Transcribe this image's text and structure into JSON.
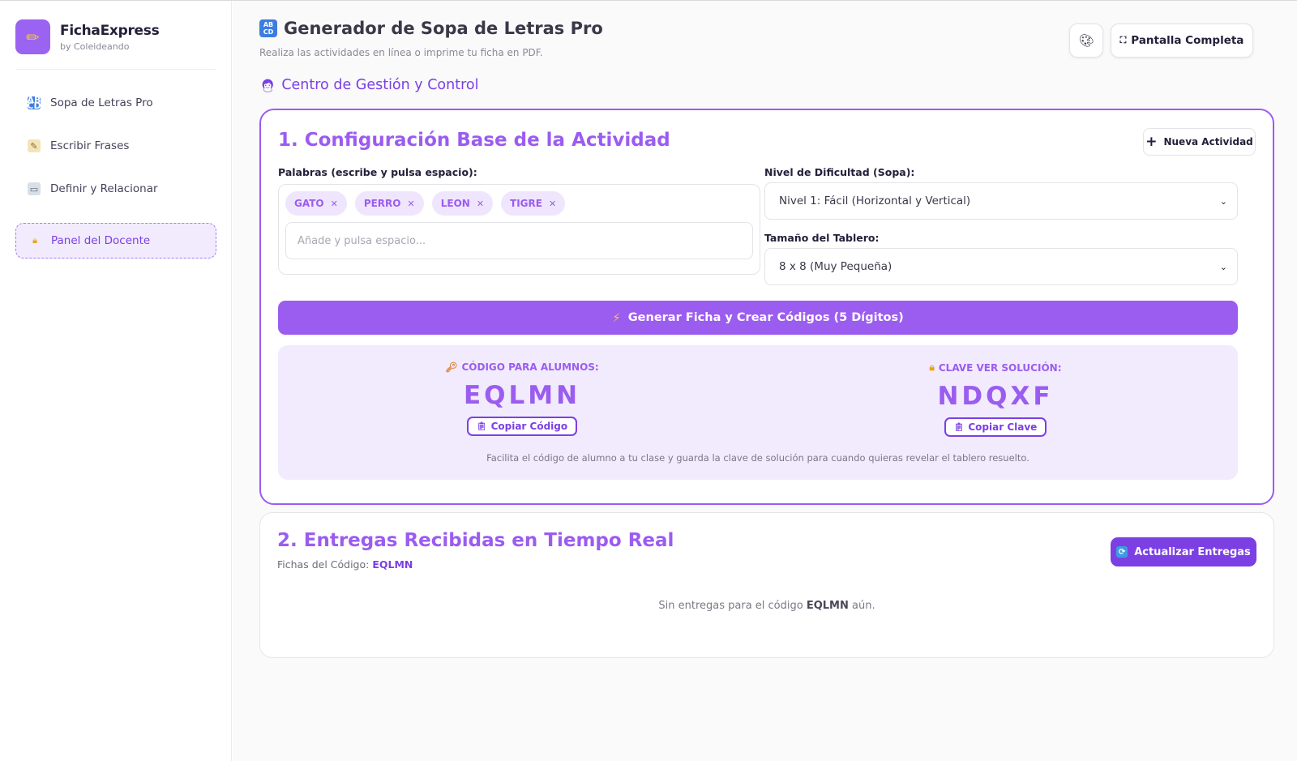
{
  "brand": {
    "name": "FichaExpress",
    "sub": "by Coleideando",
    "logo_icon": "pencil-icon"
  },
  "sidebar": {
    "items": [
      {
        "label": "Sopa de Letras Pro",
        "icon": "abcd-icon",
        "active": false
      },
      {
        "label": "Escribir Frases",
        "icon": "memo-icon",
        "active": false
      },
      {
        "label": "Definir y Relacionar",
        "icon": "book-icon",
        "active": false
      },
      {
        "label": "Panel del Docente",
        "icon": "lock-icon",
        "active": true
      }
    ]
  },
  "header": {
    "title": "Generador de Sopa de Letras Pro",
    "subtitle": "Realiza las actividades en línea o imprime tu ficha en PDF.",
    "fullscreen_label": "Pantalla Completa",
    "palette_icon": "palette-icon"
  },
  "section": {
    "title": "Centro de Gestión y Control"
  },
  "config": {
    "title": "1. Configuración Base de la Actividad",
    "new_activity_label": "Nueva Actividad",
    "words_label": "Palabras (escribe y pulsa espacio):",
    "words": [
      "GATO",
      "PERRO",
      "LEON",
      "TIGRE"
    ],
    "word_input_placeholder": "Añade y pulsa espacio...",
    "difficulty_label": "Nivel de Dificultad (Sopa):",
    "difficulty_value": "Nivel 1: Fácil (Horizontal y Vertical)",
    "size_label": "Tamaño del Tablero:",
    "size_value": "8 x 8 (Muy Pequeña)",
    "generate_label": "Generar Ficha y Crear Códigos (5 Dígitos)",
    "student_code_label": "CÓDIGO PARA ALUMNOS:",
    "student_code": "EQLMN",
    "copy_code_label": "Copiar Código",
    "solution_key_label": "CLAVE VER SOLUCIÓN:",
    "solution_key": "NDQXF",
    "copy_key_label": "Copiar Clave",
    "note": "Facilita el código de alumno a tu clase y guarda la clave de solución para cuando quieras revelar el tablero resuelto."
  },
  "deliveries": {
    "title": "2. Entregas Recibidas en Tiempo Real",
    "code_prefix": "Fichas del Código:",
    "code": "EQLMN",
    "refresh_label": "Actualizar Entregas",
    "empty_prefix": "Sin entregas para el código",
    "empty_code": "EQLMN",
    "empty_suffix": "aún."
  },
  "colors": {
    "accent": "#9b5cf0",
    "accent_dark": "#7b3fe4",
    "accent_light": "#f1ebfd"
  }
}
